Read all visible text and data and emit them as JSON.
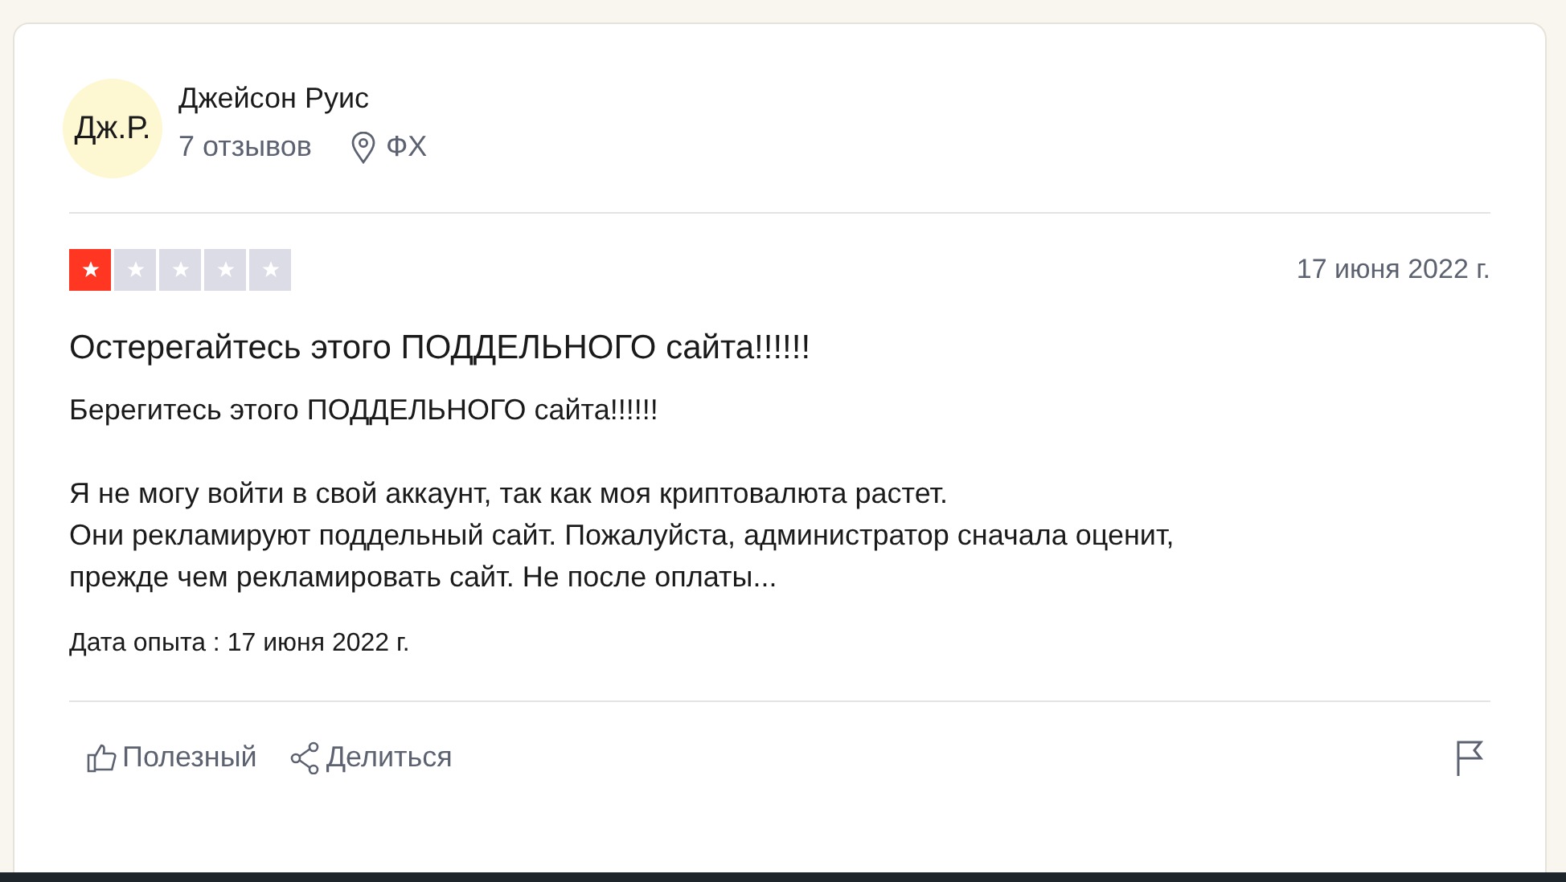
{
  "reviewer": {
    "initials": "Дж.Р.",
    "name": "Джейсон Руис",
    "reviews": "7 отзывов",
    "location": "ФХ"
  },
  "review": {
    "stars": 1,
    "date": "17 июня 2022 г.",
    "title": "Остерегайтесь этого ПОДДЕЛЬНОГО сайта!!!!!!",
    "paragraphs": [
      "Берегитесь этого ПОДДЕЛЬНОГО сайта!!!!!!",
      "Я не могу войти в свой аккаунт, так как моя криптовалюта растет.\nОни рекламируют поддельный сайт. Пожалуйста, администратор сначала оценит, прежде чем рекламировать сайт. Не после оплаты..."
    ],
    "experience": "Дата опыта : 17 июня 2022 г."
  },
  "actions": [
    "Полезный",
    "Делиться"
  ]
}
